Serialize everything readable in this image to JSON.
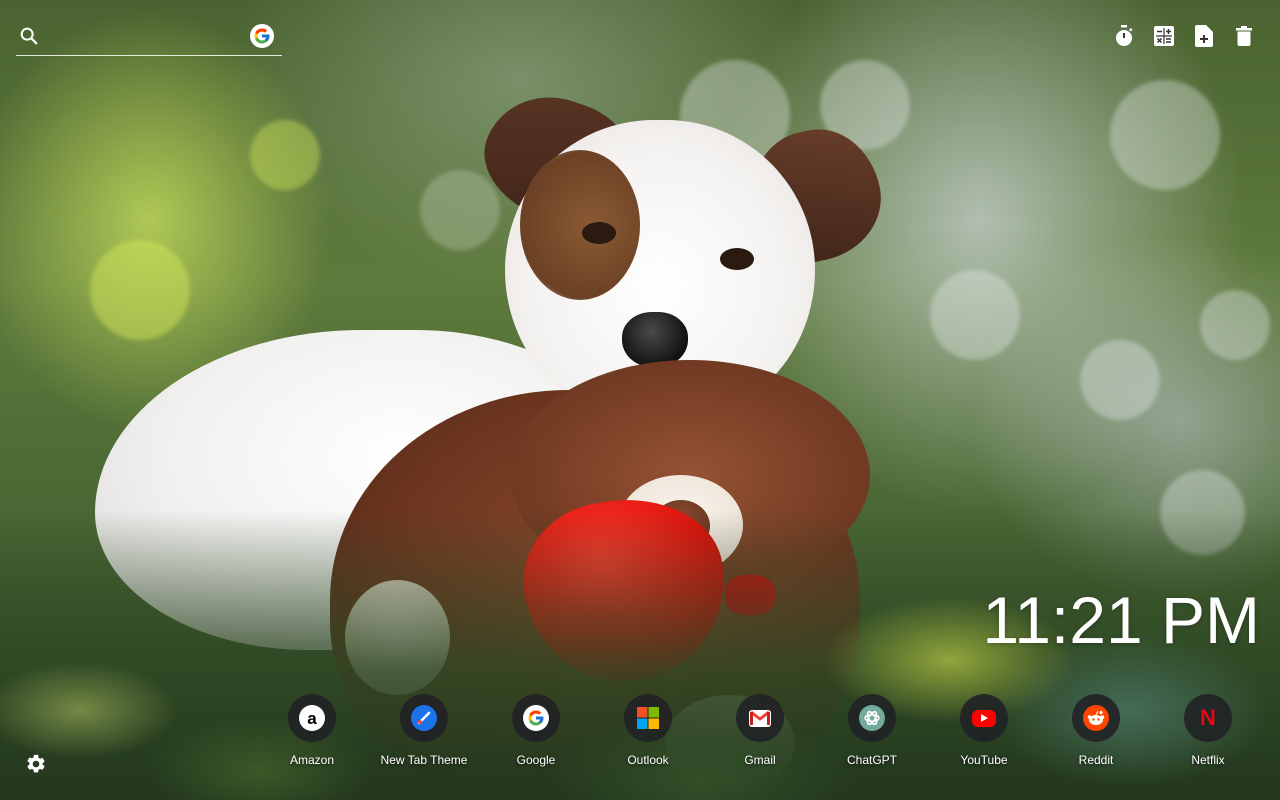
{
  "search": {
    "placeholder": "",
    "icon": "search-icon",
    "engine": "Google",
    "engine_letter": "G"
  },
  "toolbar": {
    "items": [
      {
        "name": "timer-icon"
      },
      {
        "name": "calculator-icon"
      },
      {
        "name": "new-note-icon"
      },
      {
        "name": "trash-icon"
      }
    ]
  },
  "clock": {
    "time": "11:21 PM"
  },
  "shortcuts": [
    {
      "label": "Amazon",
      "glyph": "a",
      "bg": "#ffffff",
      "fg": "#000000"
    },
    {
      "label": "New Tab Theme",
      "glyph": "✎",
      "bg": "#1a73e8",
      "fg": "#ffffff"
    },
    {
      "label": "Google",
      "glyph": "G",
      "bg": "#ffffff",
      "fg": "#4285f4"
    },
    {
      "label": "Outlook",
      "glyph": "",
      "bg": "transparent",
      "fg": "#ffffff"
    },
    {
      "label": "Gmail",
      "glyph": "M",
      "bg": "#ffffff",
      "fg": "#ea4335"
    },
    {
      "label": "ChatGPT",
      "glyph": "✺",
      "bg": "#74aa9c",
      "fg": "#ffffff"
    },
    {
      "label": "YouTube",
      "glyph": "▶",
      "bg": "#ff0000",
      "fg": "#ffffff"
    },
    {
      "label": "Reddit",
      "glyph": "●",
      "bg": "#ff4500",
      "fg": "#ffffff"
    },
    {
      "label": "Netflix",
      "glyph": "N",
      "bg": "transparent",
      "fg": "#e50914"
    }
  ],
  "settings": {
    "icon": "gear-icon"
  }
}
